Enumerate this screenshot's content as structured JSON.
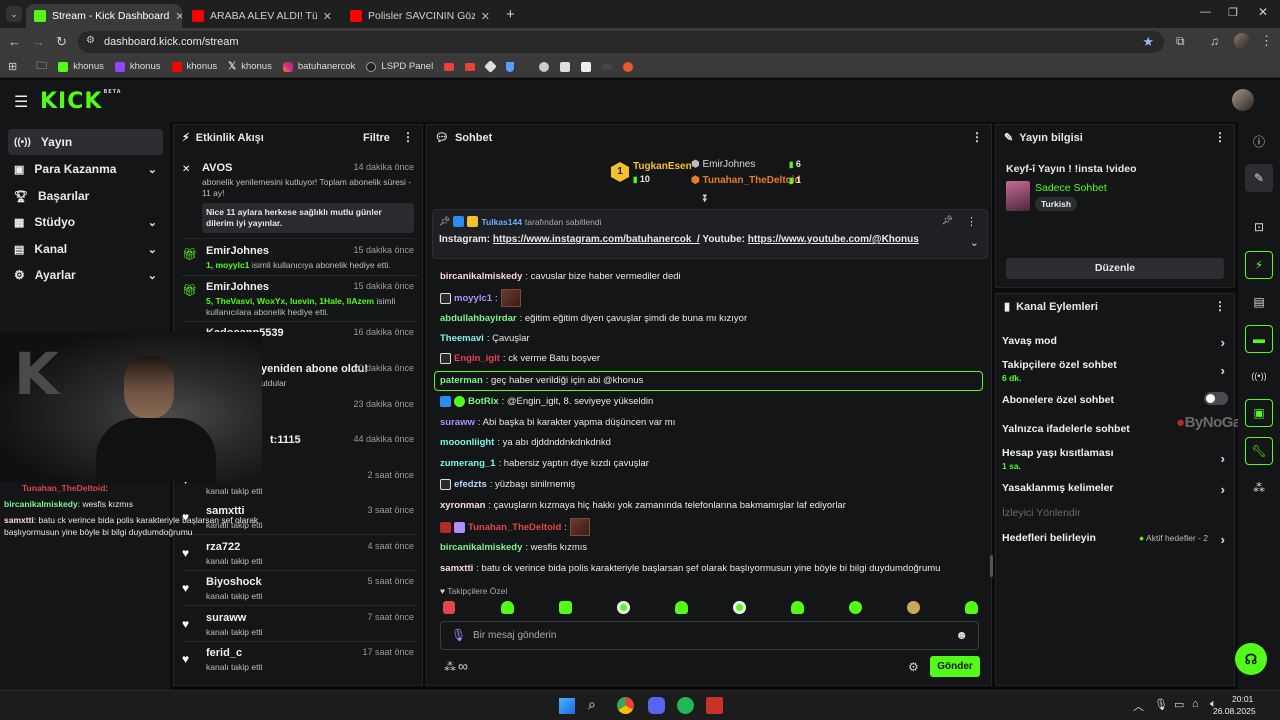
{
  "browser": {
    "tabs": [
      {
        "label": "Stream - Kick Dashboard",
        "active": true
      },
      {
        "label": "ARABA ALEV ALDI! Türkiye'de Y...",
        "active": false
      },
      {
        "label": "Polisler SAVCININ Gözünün Yaş...",
        "active": false
      }
    ],
    "url": "dashboard.kick.com/stream",
    "bookmarks": [
      "khonus",
      "khonus",
      "khonus",
      "khonus",
      "batuhanercok",
      "LSPD Panel"
    ]
  },
  "app": {
    "logo": "KICK",
    "logo_sup": "BETA"
  },
  "nav": [
    {
      "label": "Yayın",
      "chev": ""
    },
    {
      "label": "Para Kazanma",
      "chev": "⌄"
    },
    {
      "label": "Başarılar",
      "chev": ""
    },
    {
      "label": "Stüdyo",
      "chev": "⌄"
    },
    {
      "label": "Kanal",
      "chev": "⌄"
    },
    {
      "label": "Ayarlar",
      "chev": "⌄"
    }
  ],
  "activity": {
    "title": "Etkinlik Akışı",
    "filter": "Filtre",
    "events": [
      {
        "name": "AVOS",
        "time": "14 dakika önce",
        "desc": "abonelik yenilemesini kutluyor! Toplam abonelik süresi - 11 ay!",
        "note": "Nice 11 aylara herkese sağlıklı mutlu günler dilerim iyi yayınlar."
      },
      {
        "name": "EmirJohnes",
        "time": "15 dakika önce",
        "desc_user": "1, moyylc1",
        "desc": " isimli kullanıcıya abonelik hediye etti."
      },
      {
        "name": "EmirJohnes",
        "time": "15 dakika önce",
        "desc_user": "5, TheVasvi, WoxYx, luevin, 1Hale, IlAzem",
        "desc": " isimli kullanıcılara abonelik hediye etti."
      },
      {
        "name": "Kadocapp5539",
        "time": "16 dakika önce"
      },
      {
        "name": "yeniden abone oldu!",
        "time": "20 dakika önce",
        "desc": "uldular"
      },
      {
        "name": "",
        "time": "23 dakika önce"
      },
      {
        "name": "t:1115",
        "time": "44 dakika önce"
      },
      {
        "name": "",
        "time": "2 saat önce",
        "desc": "kanalı takip etti"
      },
      {
        "name": "samxtti",
        "time": "3 saat önce",
        "desc": "kanalı takip etti"
      },
      {
        "name": "rza722",
        "time": "4 saat önce",
        "desc": "kanalı takip etti"
      },
      {
        "name": "Biyoshock",
        "time": "5 saat önce",
        "desc": "kanalı takip etti"
      },
      {
        "name": "suraww",
        "time": "7 saat önce",
        "desc": "kanalı takip etti"
      },
      {
        "name": "ferid_c",
        "time": "17 saat önce",
        "desc": "kanalı takip etti"
      }
    ]
  },
  "overlay": {
    "lines": [
      {
        "user": "Tunahan_TheDeltoid",
        "text": ":"
      },
      {
        "user": "bircanikalmiskedy",
        "text": ": wesfis kızmıs"
      },
      {
        "user": "samxtti",
        "text": ": batu ck verince bida polis karakteriyle başlarsan şef olarak başlıyormusun yine böyle bi bilgi duydumdoğrumu"
      }
    ]
  },
  "chat": {
    "title": "Sohbet",
    "leaders": [
      {
        "name": "TugkanEsen",
        "count": "10",
        "rank": "1"
      },
      {
        "name": "EmirJohnes",
        "count": "6"
      },
      {
        "name": "Tunahan_TheDeltoid",
        "count": "1"
      }
    ],
    "pinned": {
      "by": "Tulkas144",
      "by_suffix": "tarafından sabitlendi",
      "text_a": "Instagram: ",
      "link_a": "https://www.instagram.com/batuhanercok_/",
      "text_b": " Youtube: ",
      "link_b": "https://www.youtube.com/@Khonus"
    },
    "messages": [
      {
        "user": "bircanikalmiskedy",
        "text": ": cavuslar bize haber vermediler dedi",
        "color": "#ffd6e0"
      },
      {
        "user": "moyylc1",
        "text": ":",
        "color": "#b28cff"
      },
      {
        "user": "abdullahbayirdar",
        "text": ": eğitim eğitim diyen çavuşlar şimdi de buna mı kızıyor",
        "color": "#7cf58a"
      },
      {
        "user": "Theemavi",
        "text": ": Çavuşlar",
        "color": "#7cf5e8"
      },
      {
        "user": "Engin_igit",
        "text": ": ck verme Batu boşver",
        "color": "#e0464b"
      },
      {
        "user": "paterman",
        "text": ": geç haber verildiği için abi @khonus",
        "color": "#7cf58a"
      },
      {
        "user": "BotRix",
        "text": ": @Engin_igit, 8. seviyeye yükseldin",
        "color": "#7cf58a"
      },
      {
        "user": "suraww",
        "text": ": Abi başka bi karakter yapma düşüncen var mı",
        "color": "#b28cff"
      },
      {
        "user": "mooonliight",
        "text": ": ya abı djddnddnkdnkdnkd",
        "color": "#7cf5e8"
      },
      {
        "user": "zumerang_1",
        "text": ": habersiz yaptın diye kızdı çavuşlar",
        "color": "#7cf5e8"
      },
      {
        "user": "efedzts",
        "text": ": yüzbaşı sinilrnemiş",
        "color": "#b8d8ff"
      },
      {
        "user": "xyronman",
        "text": ": çavuşların kızmaya hiç hakkı yok zamanında telefonlarına bakmamışlar laf ediyorlar",
        "color": "#ffd6e0"
      },
      {
        "user": "Tunahan_TheDeltoid",
        "text": ":",
        "color": "#e0464b"
      },
      {
        "user": "bircanikalmiskedy",
        "text": ": wesfis kızmıs",
        "color": "#ffd6e0"
      },
      {
        "user": "samxtti",
        "text": ": batu ck verince bida polis karakteriyle başlarsan şef olarak başlıyormusun yine böyle bi bilgi duydumdoğrumu",
        "color": "#ffd6e0"
      }
    ],
    "followers_only": "Takipçilere Özel",
    "input_placeholder": "Bir mesaj gönderin",
    "send": "Gönder"
  },
  "stream_info": {
    "title": "Yayın bilgisi",
    "stream_title": "Keyf-î Yayın ! !insta !video",
    "category": "Sadece Sohbet",
    "tag": "Turkish",
    "edit": "Düzenle"
  },
  "channel_actions": {
    "title": "Kanal Eylemleri",
    "rows": [
      {
        "label": "Yavaş mod",
        "sub": ""
      },
      {
        "label": "Takipçilere özel sohbet",
        "sub": "6 dk."
      },
      {
        "label": "Abonelere özel sohbet",
        "sub": ""
      },
      {
        "label": "Yalnızca ifadelerle sohbet",
        "sub": ""
      },
      {
        "label": "Hesap yaşı kısıtlaması",
        "sub": "1 sa."
      },
      {
        "label": "Yasaklanmış kelimeler",
        "sub": ""
      },
      {
        "label": "İzleyici Yönlendir",
        "sub": ""
      },
      {
        "label": "Hedefleri belirleyin",
        "sub": ""
      }
    ],
    "goals_status": "Aktif hedefler - 2"
  },
  "watermark": "ByNoGame",
  "taskbar": {
    "time": "20:01",
    "date": "26.08.2025"
  },
  "colors": {
    "kick_green": "#53fc18",
    "panel": "#141517"
  }
}
